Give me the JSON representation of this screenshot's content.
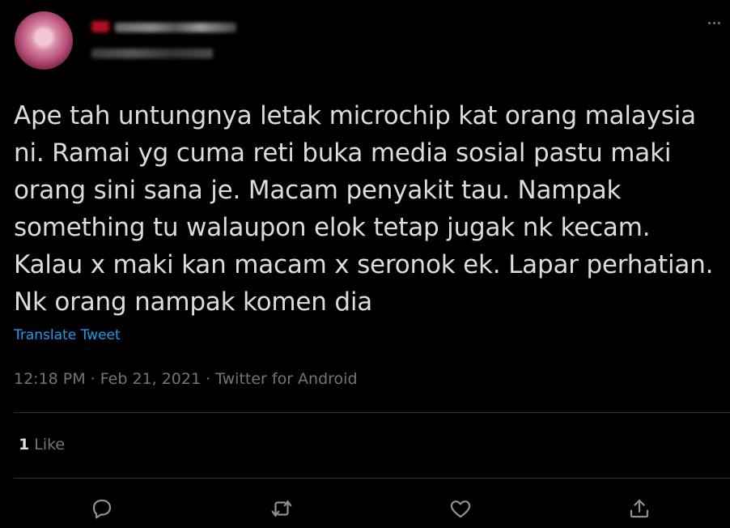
{
  "tweet": {
    "text": "Ape tah untungnya letak microchip kat orang malaysia ni. Ramai yg cuma reti buka media sosial pastu maki orang sini sana je. Macam penyakit tau. Nampak something tu walaupon elok tetap jugak nk kecam. Kalau x maki kan macam x seronok ek. Lapar perhatian. Nk orang nampak komen dia",
    "translate_label": "Translate Tweet",
    "timestamp": "12:18 PM · Feb 21, 2021 · Twitter for Android",
    "likes_count": "1",
    "likes_label": "Like"
  },
  "icons": {
    "more": "more-icon",
    "reply": "reply-icon",
    "retweet": "retweet-icon",
    "like": "heart-icon",
    "share": "share-icon"
  },
  "colors": {
    "background": "#000000",
    "text": "#dcdcdc",
    "muted": "#6e767d",
    "link": "#1d9bf0",
    "divider": "#2f3336"
  }
}
